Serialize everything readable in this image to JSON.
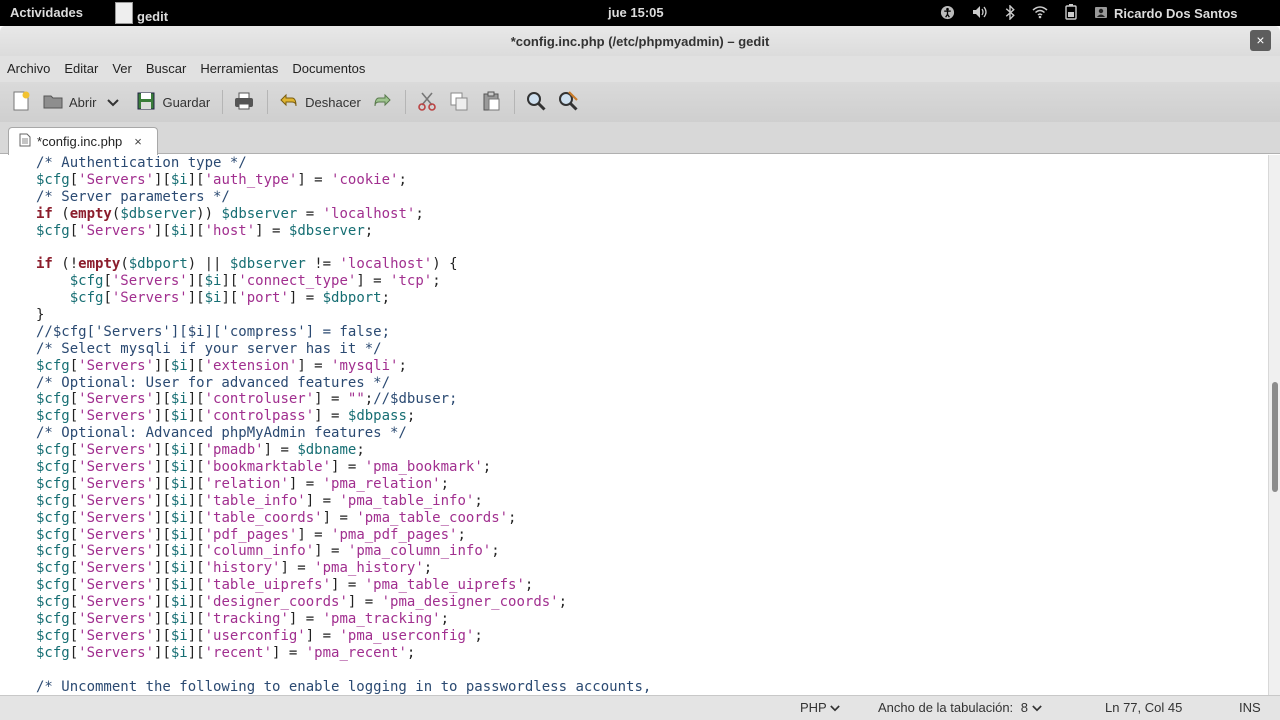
{
  "topbar": {
    "activities": "Actividades",
    "app_name": "gedit",
    "clock": "jue 15:05",
    "user": "Ricardo Dos Santos",
    "tray_icons": [
      "accessibility-icon",
      "volume-icon",
      "bluetooth-icon",
      "wifi-icon",
      "battery-icon",
      "user-icon"
    ]
  },
  "window": {
    "title": "*config.inc.php (/etc/phpmyadmin) – gedit",
    "close": "×"
  },
  "menubar": [
    "Archivo",
    "Editar",
    "Ver",
    "Buscar",
    "Herramientas",
    "Documentos"
  ],
  "toolbar": {
    "open_label": "Abrir",
    "save_label": "Guardar",
    "undo_label": "Deshacer"
  },
  "tab": {
    "label": "*config.inc.php",
    "close": "×"
  },
  "code_lines": [
    [
      [
        "c",
        "/* Authentication type */"
      ]
    ],
    [
      [
        "v",
        "$cfg"
      ],
      [
        "p",
        "["
      ],
      [
        "s",
        "'Servers'"
      ],
      [
        "p",
        "]["
      ],
      [
        "v",
        "$i"
      ],
      [
        "p",
        "]["
      ],
      [
        "s",
        "'auth_type'"
      ],
      [
        "p",
        "] = "
      ],
      [
        "s",
        "'cookie'"
      ],
      [
        "p",
        ";"
      ]
    ],
    [
      [
        "c",
        "/* Server parameters */"
      ]
    ],
    [
      [
        "k",
        "if"
      ],
      [
        "p",
        " ("
      ],
      [
        "k",
        "empty"
      ],
      [
        "p",
        "("
      ],
      [
        "v",
        "$dbserver"
      ],
      [
        "p",
        ")) "
      ],
      [
        "v",
        "$dbserver"
      ],
      [
        "p",
        " = "
      ],
      [
        "s",
        "'localhost'"
      ],
      [
        "p",
        ";"
      ]
    ],
    [
      [
        "v",
        "$cfg"
      ],
      [
        "p",
        "["
      ],
      [
        "s",
        "'Servers'"
      ],
      [
        "p",
        "]["
      ],
      [
        "v",
        "$i"
      ],
      [
        "p",
        "]["
      ],
      [
        "s",
        "'host'"
      ],
      [
        "p",
        "] = "
      ],
      [
        "v",
        "$dbserver"
      ],
      [
        "p",
        ";"
      ]
    ],
    [],
    [
      [
        "k",
        "if"
      ],
      [
        "p",
        " (!"
      ],
      [
        "k",
        "empty"
      ],
      [
        "p",
        "("
      ],
      [
        "v",
        "$dbport"
      ],
      [
        "p",
        ") || "
      ],
      [
        "v",
        "$dbserver"
      ],
      [
        "p",
        " != "
      ],
      [
        "s",
        "'localhost'"
      ],
      [
        "p",
        ") {"
      ]
    ],
    [
      [
        "p",
        "    "
      ],
      [
        "v",
        "$cfg"
      ],
      [
        "p",
        "["
      ],
      [
        "s",
        "'Servers'"
      ],
      [
        "p",
        "]["
      ],
      [
        "v",
        "$i"
      ],
      [
        "p",
        "]["
      ],
      [
        "s",
        "'connect_type'"
      ],
      [
        "p",
        "] = "
      ],
      [
        "s",
        "'tcp'"
      ],
      [
        "p",
        ";"
      ]
    ],
    [
      [
        "p",
        "    "
      ],
      [
        "v",
        "$cfg"
      ],
      [
        "p",
        "["
      ],
      [
        "s",
        "'Servers'"
      ],
      [
        "p",
        "]["
      ],
      [
        "v",
        "$i"
      ],
      [
        "p",
        "]["
      ],
      [
        "s",
        "'port'"
      ],
      [
        "p",
        "] = "
      ],
      [
        "v",
        "$dbport"
      ],
      [
        "p",
        ";"
      ]
    ],
    [
      [
        "p",
        "}"
      ]
    ],
    [
      [
        "c",
        "//$cfg['Servers'][$i]['compress'] = false;"
      ]
    ],
    [
      [
        "c",
        "/* Select mysqli if your server has it */"
      ]
    ],
    [
      [
        "v",
        "$cfg"
      ],
      [
        "p",
        "["
      ],
      [
        "s",
        "'Servers'"
      ],
      [
        "p",
        "]["
      ],
      [
        "v",
        "$i"
      ],
      [
        "p",
        "]["
      ],
      [
        "s",
        "'extension'"
      ],
      [
        "p",
        "] = "
      ],
      [
        "s",
        "'mysqli'"
      ],
      [
        "p",
        ";"
      ]
    ],
    [
      [
        "c",
        "/* Optional: User for advanced features */"
      ]
    ],
    [
      [
        "v",
        "$cfg"
      ],
      [
        "p",
        "["
      ],
      [
        "s",
        "'Servers'"
      ],
      [
        "p",
        "]["
      ],
      [
        "v",
        "$i"
      ],
      [
        "p",
        "]["
      ],
      [
        "s",
        "'controluser'"
      ],
      [
        "p",
        "] = "
      ],
      [
        "s",
        "\"\""
      ],
      [
        "p",
        ";"
      ],
      [
        "c",
        "//$dbuser;"
      ]
    ],
    [
      [
        "v",
        "$cfg"
      ],
      [
        "p",
        "["
      ],
      [
        "s",
        "'Servers'"
      ],
      [
        "p",
        "]["
      ],
      [
        "v",
        "$i"
      ],
      [
        "p",
        "]["
      ],
      [
        "s",
        "'controlpass'"
      ],
      [
        "p",
        "] = "
      ],
      [
        "v",
        "$dbpass"
      ],
      [
        "p",
        ";"
      ]
    ],
    [
      [
        "c",
        "/* Optional: Advanced phpMyAdmin features */"
      ]
    ],
    [
      [
        "v",
        "$cfg"
      ],
      [
        "p",
        "["
      ],
      [
        "s",
        "'Servers'"
      ],
      [
        "p",
        "]["
      ],
      [
        "v",
        "$i"
      ],
      [
        "p",
        "]["
      ],
      [
        "s",
        "'pmadb'"
      ],
      [
        "p",
        "] = "
      ],
      [
        "v",
        "$dbname"
      ],
      [
        "p",
        ";"
      ]
    ],
    [
      [
        "v",
        "$cfg"
      ],
      [
        "p",
        "["
      ],
      [
        "s",
        "'Servers'"
      ],
      [
        "p",
        "]["
      ],
      [
        "v",
        "$i"
      ],
      [
        "p",
        "]["
      ],
      [
        "s",
        "'bookmarktable'"
      ],
      [
        "p",
        "] = "
      ],
      [
        "s",
        "'pma_bookmark'"
      ],
      [
        "p",
        ";"
      ]
    ],
    [
      [
        "v",
        "$cfg"
      ],
      [
        "p",
        "["
      ],
      [
        "s",
        "'Servers'"
      ],
      [
        "p",
        "]["
      ],
      [
        "v",
        "$i"
      ],
      [
        "p",
        "]["
      ],
      [
        "s",
        "'relation'"
      ],
      [
        "p",
        "] = "
      ],
      [
        "s",
        "'pma_relation'"
      ],
      [
        "p",
        ";"
      ]
    ],
    [
      [
        "v",
        "$cfg"
      ],
      [
        "p",
        "["
      ],
      [
        "s",
        "'Servers'"
      ],
      [
        "p",
        "]["
      ],
      [
        "v",
        "$i"
      ],
      [
        "p",
        "]["
      ],
      [
        "s",
        "'table_info'"
      ],
      [
        "p",
        "] = "
      ],
      [
        "s",
        "'pma_table_info'"
      ],
      [
        "p",
        ";"
      ]
    ],
    [
      [
        "v",
        "$cfg"
      ],
      [
        "p",
        "["
      ],
      [
        "s",
        "'Servers'"
      ],
      [
        "p",
        "]["
      ],
      [
        "v",
        "$i"
      ],
      [
        "p",
        "]["
      ],
      [
        "s",
        "'table_coords'"
      ],
      [
        "p",
        "] = "
      ],
      [
        "s",
        "'pma_table_coords'"
      ],
      [
        "p",
        ";"
      ]
    ],
    [
      [
        "v",
        "$cfg"
      ],
      [
        "p",
        "["
      ],
      [
        "s",
        "'Servers'"
      ],
      [
        "p",
        "]["
      ],
      [
        "v",
        "$i"
      ],
      [
        "p",
        "]["
      ],
      [
        "s",
        "'pdf_pages'"
      ],
      [
        "p",
        "] = "
      ],
      [
        "s",
        "'pma_pdf_pages'"
      ],
      [
        "p",
        ";"
      ]
    ],
    [
      [
        "v",
        "$cfg"
      ],
      [
        "p",
        "["
      ],
      [
        "s",
        "'Servers'"
      ],
      [
        "p",
        "]["
      ],
      [
        "v",
        "$i"
      ],
      [
        "p",
        "]["
      ],
      [
        "s",
        "'column_info'"
      ],
      [
        "p",
        "] = "
      ],
      [
        "s",
        "'pma_column_info'"
      ],
      [
        "p",
        ";"
      ]
    ],
    [
      [
        "v",
        "$cfg"
      ],
      [
        "p",
        "["
      ],
      [
        "s",
        "'Servers'"
      ],
      [
        "p",
        "]["
      ],
      [
        "v",
        "$i"
      ],
      [
        "p",
        "]["
      ],
      [
        "s",
        "'history'"
      ],
      [
        "p",
        "] = "
      ],
      [
        "s",
        "'pma_history'"
      ],
      [
        "p",
        ";"
      ]
    ],
    [
      [
        "v",
        "$cfg"
      ],
      [
        "p",
        "["
      ],
      [
        "s",
        "'Servers'"
      ],
      [
        "p",
        "]["
      ],
      [
        "v",
        "$i"
      ],
      [
        "p",
        "]["
      ],
      [
        "s",
        "'table_uiprefs'"
      ],
      [
        "p",
        "] = "
      ],
      [
        "s",
        "'pma_table_uiprefs'"
      ],
      [
        "p",
        ";"
      ]
    ],
    [
      [
        "v",
        "$cfg"
      ],
      [
        "p",
        "["
      ],
      [
        "s",
        "'Servers'"
      ],
      [
        "p",
        "]["
      ],
      [
        "v",
        "$i"
      ],
      [
        "p",
        "]["
      ],
      [
        "s",
        "'designer_coords'"
      ],
      [
        "p",
        "] = "
      ],
      [
        "s",
        "'pma_designer_coords'"
      ],
      [
        "p",
        ";"
      ]
    ],
    [
      [
        "v",
        "$cfg"
      ],
      [
        "p",
        "["
      ],
      [
        "s",
        "'Servers'"
      ],
      [
        "p",
        "]["
      ],
      [
        "v",
        "$i"
      ],
      [
        "p",
        "]["
      ],
      [
        "s",
        "'tracking'"
      ],
      [
        "p",
        "] = "
      ],
      [
        "s",
        "'pma_tracking'"
      ],
      [
        "p",
        ";"
      ]
    ],
    [
      [
        "v",
        "$cfg"
      ],
      [
        "p",
        "["
      ],
      [
        "s",
        "'Servers'"
      ],
      [
        "p",
        "]["
      ],
      [
        "v",
        "$i"
      ],
      [
        "p",
        "]["
      ],
      [
        "s",
        "'userconfig'"
      ],
      [
        "p",
        "] = "
      ],
      [
        "s",
        "'pma_userconfig'"
      ],
      [
        "p",
        ";"
      ]
    ],
    [
      [
        "v",
        "$cfg"
      ],
      [
        "p",
        "["
      ],
      [
        "s",
        "'Servers'"
      ],
      [
        "p",
        "]["
      ],
      [
        "v",
        "$i"
      ],
      [
        "p",
        "]["
      ],
      [
        "s",
        "'recent'"
      ],
      [
        "p",
        "] = "
      ],
      [
        "s",
        "'pma_recent'"
      ],
      [
        "p",
        ";"
      ]
    ],
    [],
    [
      [
        "c",
        "/* Uncomment the following to enable logging in to passwordless accounts,"
      ]
    ]
  ],
  "statusbar": {
    "language": "PHP",
    "tab_width_label": "Ancho de la tabulación:",
    "tab_width": "8",
    "position": "Ln 77, Col 45",
    "mode": "INS"
  },
  "colors": {
    "comment": "#2b4a72",
    "variable": "#166e73",
    "string": "#a12f8f",
    "keyword": "#8b1d2c"
  }
}
